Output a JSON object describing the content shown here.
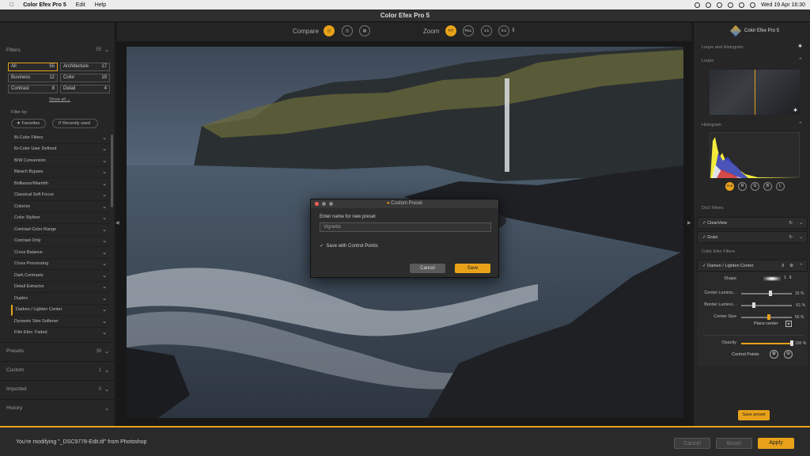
{
  "menubar": {
    "app": "Color Efex Pro 5",
    "items": [
      "Edit",
      "Help"
    ],
    "datetime": "Wed 19 Apr  16:30"
  },
  "window": {
    "title": "Color Efex Pro 5"
  },
  "left": {
    "filters_header": "Filters",
    "filters_count": "55",
    "categories": [
      {
        "label": "All",
        "count": "55"
      },
      {
        "label": "Architecture",
        "count": "17"
      },
      {
        "label": "Business",
        "count": "12"
      },
      {
        "label": "Color",
        "count": "19"
      },
      {
        "label": "Contrast",
        "count": "8"
      },
      {
        "label": "Detail",
        "count": "4"
      }
    ],
    "show_all": "Show all",
    "filter_by": "Filter by:",
    "favorites": "Favorites",
    "recently_used": "Recently used",
    "filters": [
      "Bi-Color Filters",
      "Bi-Color User Defined",
      "B/W Conversion",
      "Bleach Bypass",
      "Brilliance/Warmth",
      "Classical Soft Focus",
      "Colorize",
      "Color Stylizer",
      "Contrast Color Range",
      "Contrast Only",
      "Cross Balance",
      "Cross Processing",
      "Dark Contrasts",
      "Detail Extractor",
      "Duplex",
      "Darken / Lighten Center",
      "Dynamic Skin Softener",
      "Film Efex: Faded"
    ],
    "presets": {
      "label": "Presets",
      "count": "39"
    },
    "custom": {
      "label": "Custom",
      "count": "1"
    },
    "imported": {
      "label": "Imported",
      "count": "0"
    },
    "history": {
      "label": "History"
    }
  },
  "toolbar": {
    "compare": "Compare",
    "zoom": "Zoom",
    "zoom_options": [
      "FIT",
      "FILL",
      "1:1",
      "2:1"
    ]
  },
  "dialog": {
    "title": "Custom Preset",
    "prompt": "Enter name for new preset",
    "name_value": "Vignette",
    "checkbox_label": "Save with Control Points",
    "cancel": "Cancel",
    "save": "Save"
  },
  "right": {
    "brand": "Color Efex Pro 5",
    "loupe_histogram": "Loupe and Histogram",
    "loupe": "Loupe",
    "histogram": "Histogram",
    "hist_buttons": [
      "RGB",
      "R",
      "G",
      "B",
      "L"
    ],
    "dxo_filters": "DxO Filters",
    "clearview": "ClearView",
    "grain": "Grain",
    "cep_filters": "Color Efex Filters",
    "active_filter": "Darken / Lighten Center",
    "shape_label": "Shape",
    "shape_value": "1",
    "sliders": [
      {
        "label": "Center Lumino...",
        "value": "15 %",
        "level": 0.58
      },
      {
        "label": "Border Lumino...",
        "value": "-51 %",
        "level": 0.25
      },
      {
        "label": "Center Size",
        "value": "55 %",
        "level": 0.55
      }
    ],
    "place_center": "Place center",
    "opacity_label": "Opacity",
    "opacity_value": "100 %",
    "control_points": "Control Points",
    "save_preset": "Save preset"
  },
  "bottom": {
    "status": "You're modifying \"_DSC9778-Edit.tif\" from Photoshop",
    "cancel": "Cancel",
    "brush": "Brush",
    "apply": "Apply"
  },
  "colors": {
    "accent": "#e8a21a",
    "panel": "#262626",
    "menubar": "#ececec"
  }
}
